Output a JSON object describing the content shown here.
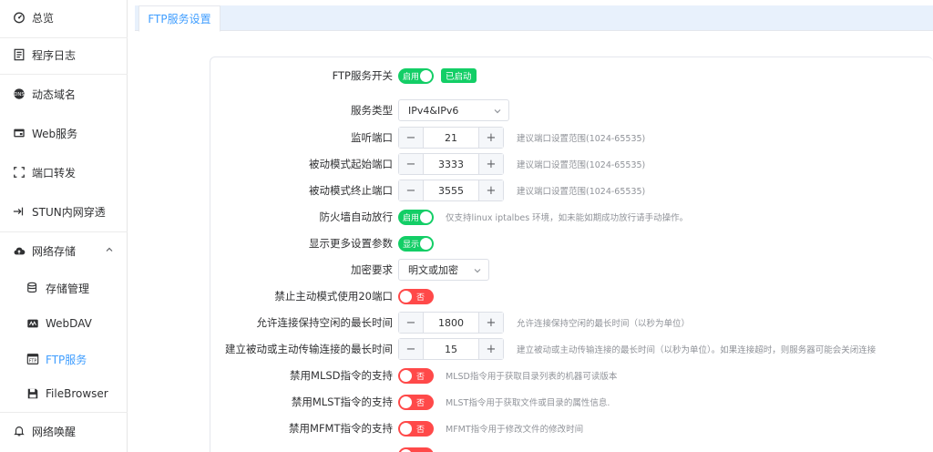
{
  "sidebar": {
    "items": [
      {
        "label": "总览",
        "icon": "dashboard-icon"
      },
      {
        "label": "程序日志",
        "icon": "log-icon"
      },
      {
        "label": "动态域名",
        "icon": "ddns-icon"
      },
      {
        "label": "Web服务",
        "icon": "web-icon"
      },
      {
        "label": "端口转发",
        "icon": "port-forward-icon"
      },
      {
        "label": "STUN内网穿透",
        "icon": "stun-icon"
      },
      {
        "label": "网络存储",
        "icon": "cloud-storage-icon"
      },
      {
        "label": "存储管理",
        "icon": "storage-manage-icon"
      },
      {
        "label": "WebDAV",
        "icon": "webdav-icon"
      },
      {
        "label": "FTP服务",
        "icon": "ftp-icon"
      },
      {
        "label": "FileBrowser",
        "icon": "filebrowser-icon"
      },
      {
        "label": "网络唤醒",
        "icon": "bell-icon"
      }
    ]
  },
  "tabs": {
    "active": "FTP服务设置"
  },
  "form": {
    "ftp_switch": {
      "label": "FTP服务开关",
      "switch_text": "启用",
      "status_tag": "已启动"
    },
    "service_type": {
      "label": "服务类型",
      "value": "IPv4&IPv6"
    },
    "listen_port": {
      "label": "监听端口",
      "value": "21",
      "hint": "建议端口设置范围(1024-65535)"
    },
    "passive_start": {
      "label": "被动模式起始端口",
      "value": "3333",
      "hint": "建议端口设置范围(1024-65535)"
    },
    "passive_end": {
      "label": "被动模式终止端口",
      "value": "3555",
      "hint": "建议端口设置范围(1024-65535)"
    },
    "firewall": {
      "label": "防火墙自动放行",
      "switch_text": "启用",
      "hint": "仅支持linux iptalbes 环境，如未能如期成功放行请手动操作。"
    },
    "more_params": {
      "label": "显示更多设置参数",
      "switch_text": "显示"
    },
    "encryption": {
      "label": "加密要求",
      "value": "明文或加密"
    },
    "no_port20": {
      "label": "禁止主动模式使用20端口",
      "switch_text": "否"
    },
    "idle_time": {
      "label": "允许连接保持空闲的最长时间",
      "value": "1800",
      "hint": "允许连接保持空闲的最长时间（以秒为单位）"
    },
    "conn_time": {
      "label": "建立被动或主动传输连接的最长时间",
      "value": "15",
      "hint": "建立被动或主动传输连接的最长时间（以秒为单位）。如果连接超时，则服务器可能会关闭连接"
    },
    "mlsd": {
      "label": "禁用MLSD指令的支持",
      "switch_text": "否",
      "hint": "MLSD指令用于获取目录列表的机器可读版本"
    },
    "mlst": {
      "label": "禁用MLST指令的支持",
      "switch_text": "否",
      "hint": "MLST指令用于获取文件或目录的属性信息."
    },
    "mfmt": {
      "label": "禁用MFMT指令的支持",
      "switch_text": "否",
      "hint": "MFMT指令用于修改文件的修改时间"
    }
  },
  "colors": {
    "accent": "#409eff",
    "switch_on": "#13ce66",
    "switch_off": "#ff4949"
  }
}
